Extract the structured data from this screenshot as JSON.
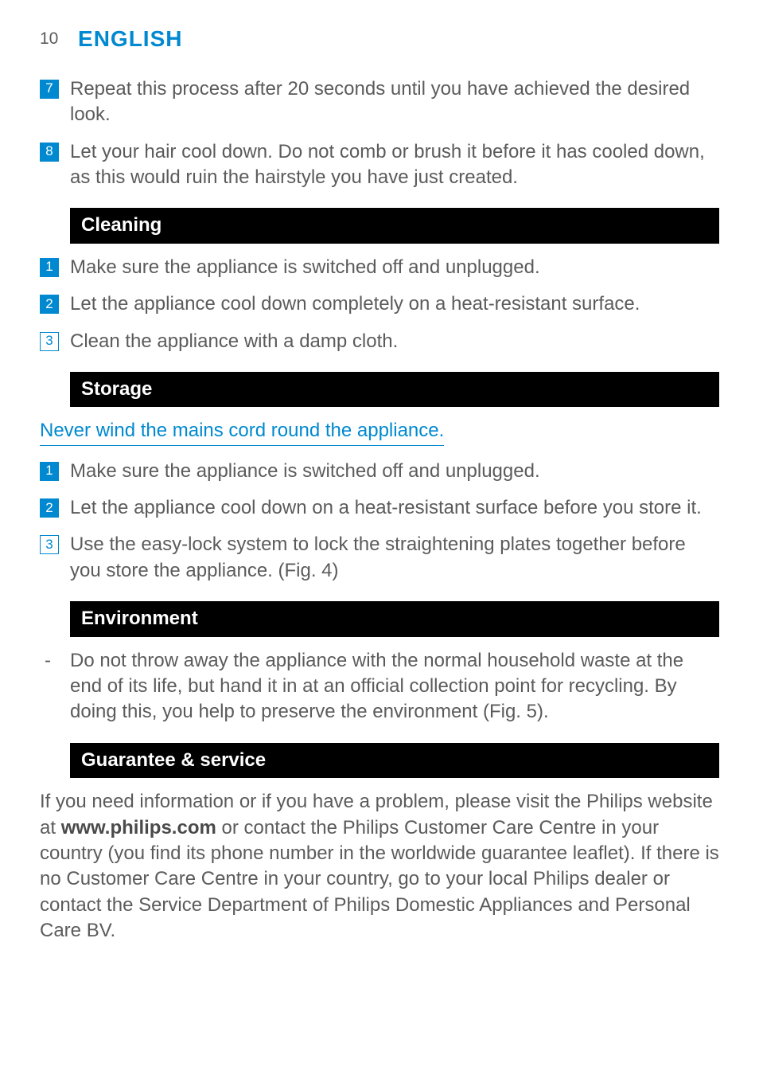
{
  "header": {
    "page_num": "10",
    "lang": "ENGLISH"
  },
  "intro_steps": [
    {
      "num": "7",
      "filled": true,
      "text": "Repeat this process after 20 seconds until you have achieved the desired look."
    },
    {
      "num": "8",
      "filled": true,
      "text": "Let your hair cool down. Do not comb or brush it before it has cooled down, as this would ruin the hairstyle you have just created."
    }
  ],
  "cleaning": {
    "title": "Cleaning",
    "steps": [
      {
        "num": "1",
        "filled": true,
        "text": "Make sure the appliance is switched off and unplugged."
      },
      {
        "num": "2",
        "filled": true,
        "text": "Let the appliance cool down completely on a heat-resistant surface."
      },
      {
        "num": "3",
        "filled": false,
        "text": "Clean the appliance with a damp cloth."
      }
    ]
  },
  "storage": {
    "title": "Storage",
    "note": "Never wind the mains cord round the appliance.",
    "steps": [
      {
        "num": "1",
        "filled": true,
        "text": "Make sure the appliance is switched off and unplugged."
      },
      {
        "num": "2",
        "filled": true,
        "text": "Let the appliance cool down on a heat-resistant surface before you store it."
      },
      {
        "num": "3",
        "filled": false,
        "text": "Use the easy-lock system to lock the straightening plates together before you store the appliance.  (Fig. 4)"
      }
    ]
  },
  "environment": {
    "title": "Environment",
    "bullets": [
      "Do not throw away the appliance with the normal household waste at the end of its life, but hand it in at an official collection point for recycling. By doing this, you help to preserve the environment (Fig. 5)."
    ]
  },
  "guarantee": {
    "title": "Guarantee & service",
    "para_before": "If you need information or if you have a problem, please visit the Philips website at ",
    "para_bold": "www.philips.com",
    "para_after": " or contact the Philips Customer Care Centre in your country (you find its phone number in the worldwide guarantee leaflet). If there is no Customer Care Centre in your country, go to your local Philips dealer or contact the Service Department of Philips Domestic Appliances and Personal Care BV."
  }
}
